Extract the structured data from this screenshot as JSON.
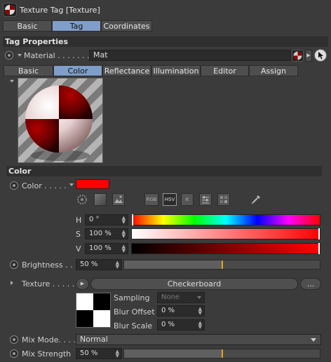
{
  "window": {
    "title": "Texture Tag [Texture]",
    "icon": "texture-tag-icon"
  },
  "top_tabs": [
    {
      "label": "Basic",
      "active": false
    },
    {
      "label": "Tag",
      "active": true
    },
    {
      "label": "Coordinates",
      "active": false
    }
  ],
  "tag_properties": {
    "header": "Tag Properties",
    "material_label": "Material . . . . . . .",
    "material_value": "Mat"
  },
  "material_tabs": [
    {
      "label": "Basic",
      "active": false
    },
    {
      "label": "Color",
      "active": true
    },
    {
      "label": "Reflectance",
      "active": false
    },
    {
      "label": "Illumination",
      "active": false
    },
    {
      "label": "Editor",
      "active": false
    },
    {
      "label": "Assign",
      "active": false
    }
  ],
  "color_section": {
    "header": "Color",
    "color_label": "Color . . . . .",
    "swatch_color": "#ff0000",
    "mode_buttons": [
      "RGB",
      "HSV",
      "K"
    ],
    "active_mode": "HSV",
    "h": {
      "label": "H",
      "value": "0 °"
    },
    "s": {
      "label": "S",
      "value": "100 %"
    },
    "v": {
      "label": "V",
      "value": "100 %"
    },
    "brightness_label": "Brightness . . .",
    "brightness_value": "50 %",
    "brightness_fraction": 0.5
  },
  "texture": {
    "label": "Texture . . . . . . .",
    "shader_name": "Checkerboard",
    "more_button": "...",
    "sampling_label": "Sampling",
    "sampling_value": "None",
    "blur_offset_label": "Blur Offset",
    "blur_offset_value": "0 %",
    "blur_scale_label": "Blur Scale",
    "blur_scale_value": "0 %"
  },
  "mix": {
    "mode_label": "Mix Mode. . . .",
    "mode_value": "Normal",
    "strength_label": "Mix Strength",
    "strength_value": "50 %",
    "strength_fraction": 0.5
  },
  "colors": {
    "accent": "#7f9ec9",
    "slider_mark": "#e8a21a",
    "checker_dark": "#5a0000"
  }
}
